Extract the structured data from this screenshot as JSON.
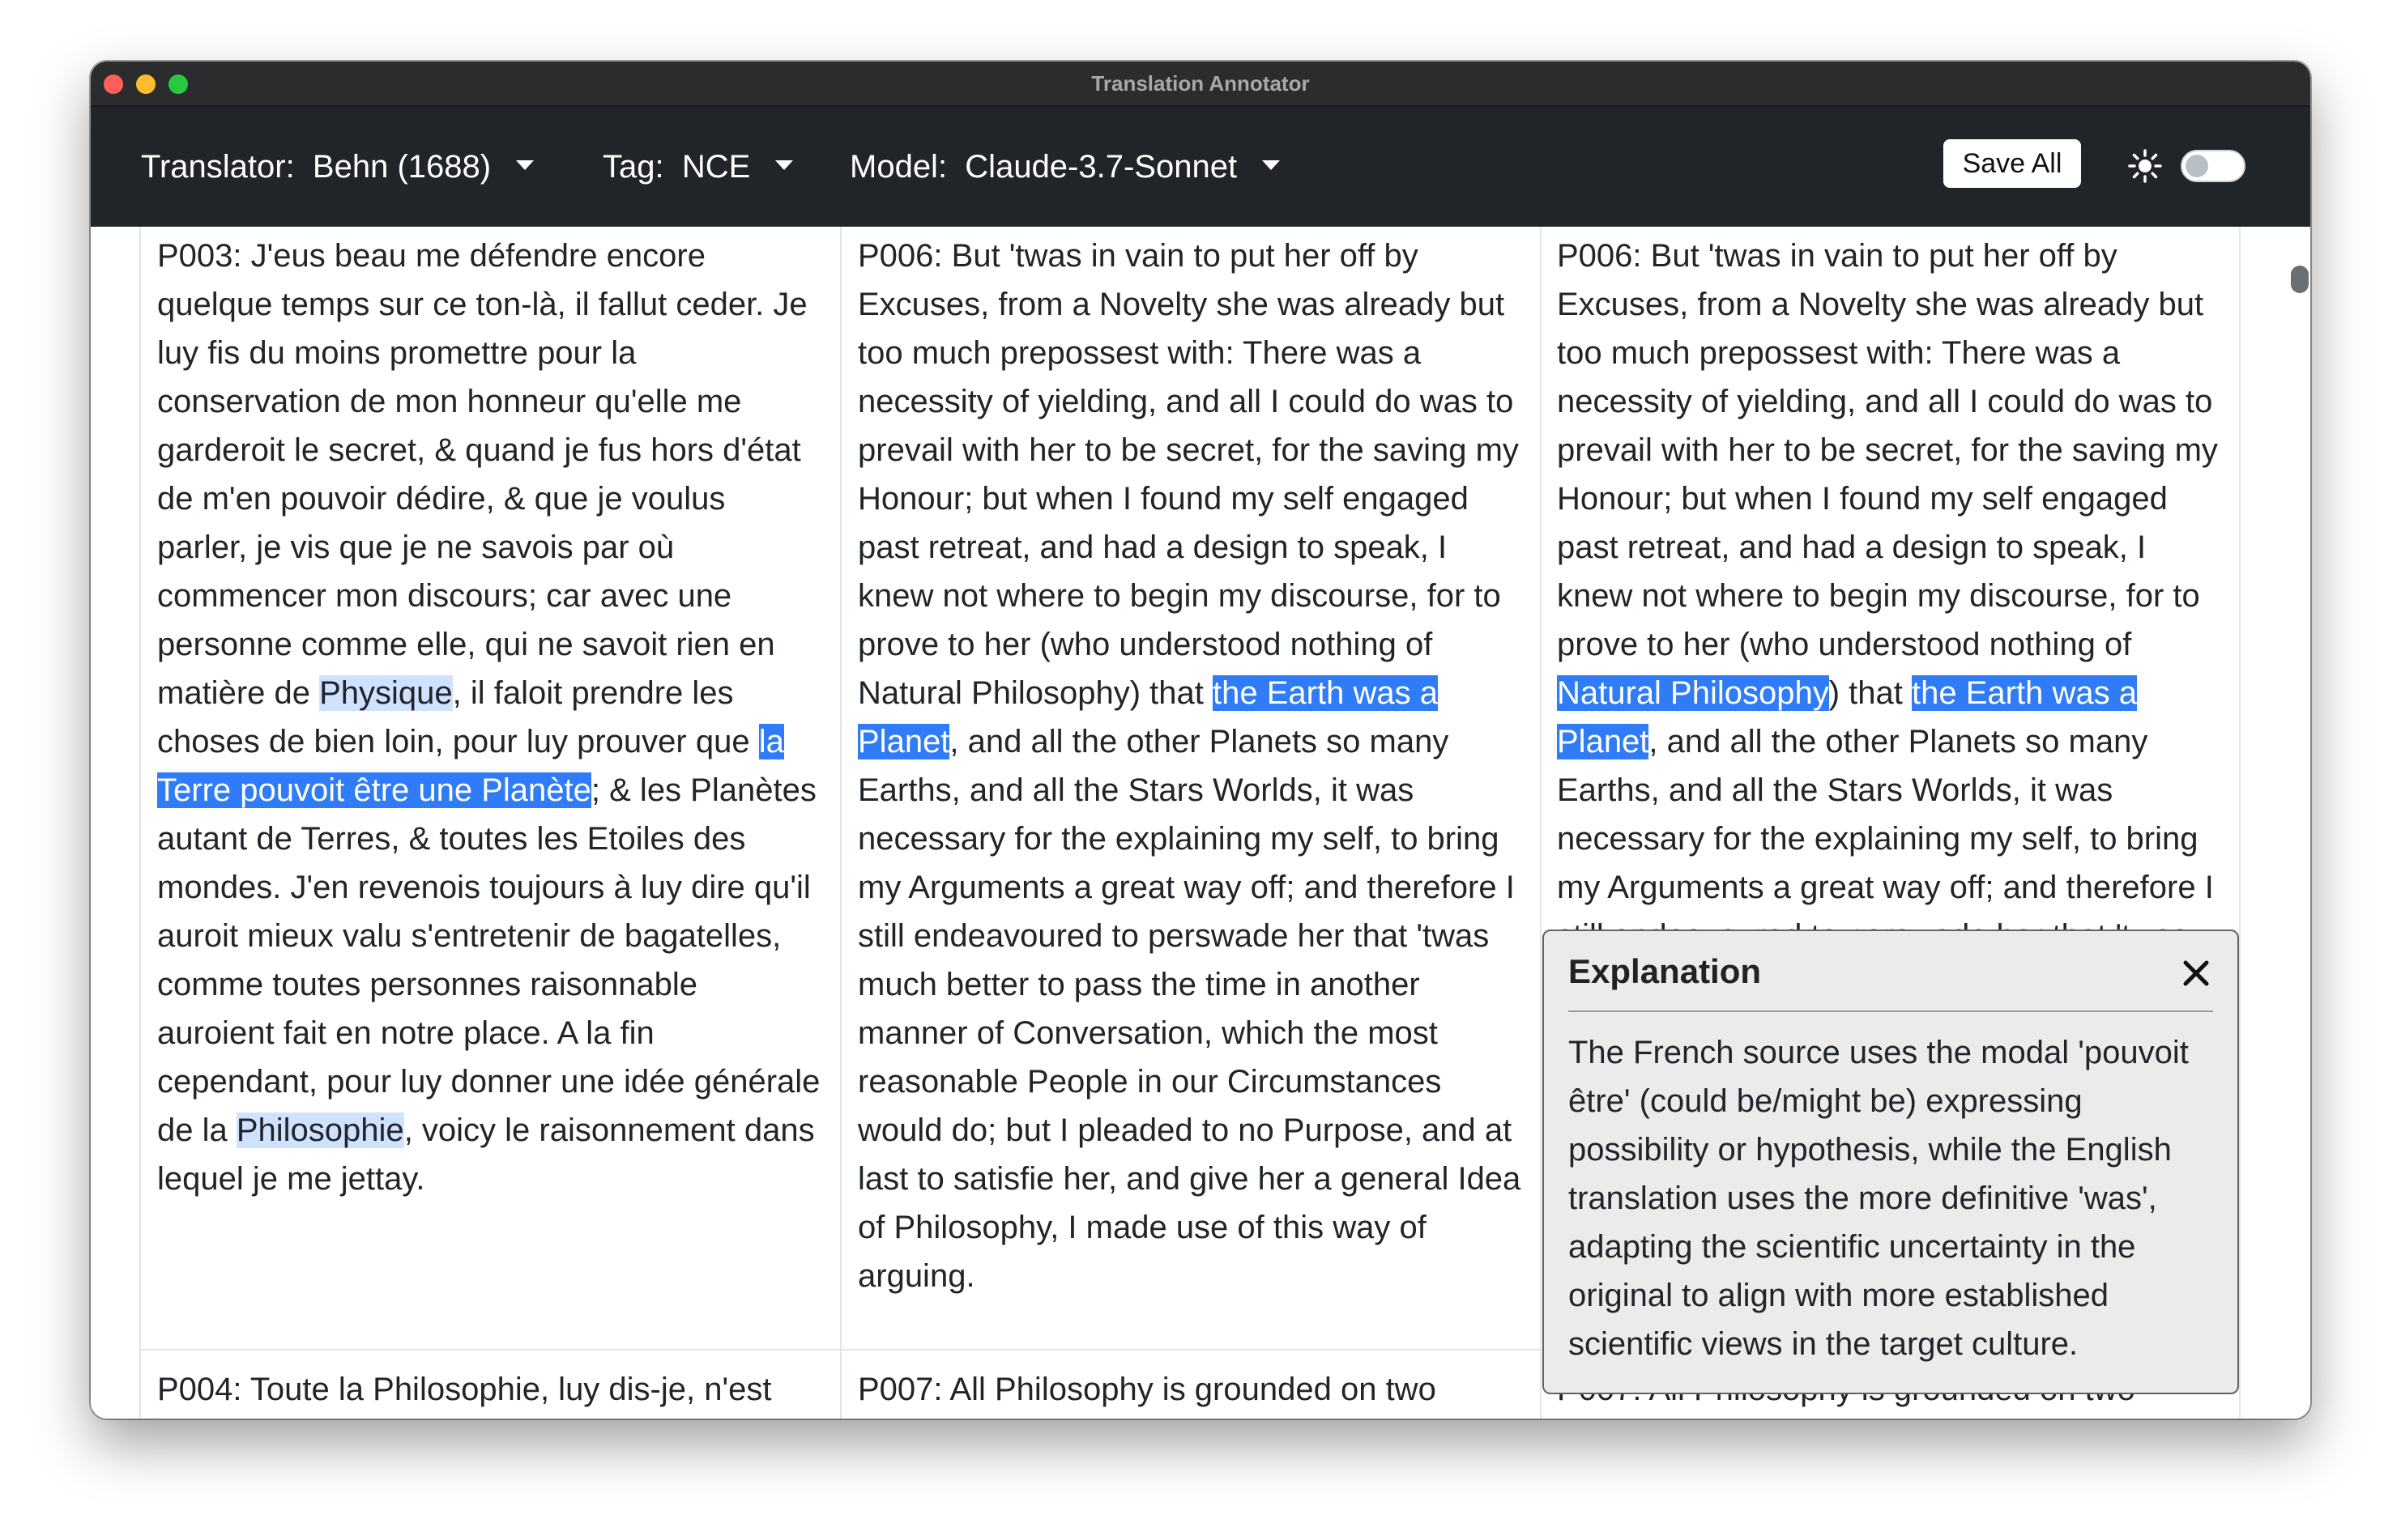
{
  "window": {
    "title": "Translation Annotator"
  },
  "toolbar": {
    "translator_label": "Translator:",
    "translator_value": "Behn (1688)",
    "tag_label": "Tag:",
    "tag_value": "NCE",
    "model_label": "Model:",
    "model_value": "Claude-3.7-Sonnet",
    "save_label": "Save All",
    "theme_icon": "sun-icon",
    "theme_toggle_on": false
  },
  "rows": [
    {
      "source_lines": [
        [
          "P003: J'eus beau me défendre encore"
        ],
        [
          "quelque temps sur ce ton-là, il fallut ceder. Je"
        ],
        [
          "luy fis du moins promettre pour la"
        ],
        [
          "conservation de mon honneur qu'elle me"
        ],
        [
          "garderoit le secret, & quand je fus hors d'état"
        ],
        [
          "de m'en pouvoir dédire, & que je voulus"
        ],
        [
          "parler, je vis que je ne savois par où"
        ],
        [
          "commencer mon discours; car avec une"
        ],
        [
          "personne comme elle, qui ne savoit rien en"
        ],
        [
          "matière de ",
          {
            "t": "Physique",
            "h": "soft"
          },
          ", il faloit prendre les"
        ],
        [
          "choses de bien loin, pour luy prouver que ",
          {
            "t": "la",
            "h": "strong"
          }
        ],
        [
          {
            "t": "Terre pouvoit être une Planète",
            "h": "strong"
          },
          "; & les Planètes"
        ],
        [
          "autant de Terres, & toutes les Etoiles des"
        ],
        [
          "mondes. J'en revenois toujours à luy dire qu'il"
        ],
        [
          "auroit mieux valu s'entretenir de bagatelles,"
        ],
        [
          "comme toutes personnes raisonnable"
        ],
        [
          "auroient fait en notre place. A la fin"
        ],
        [
          "cependant, pour luy donner une idée générale"
        ],
        [
          "de la ",
          {
            "t": "Philosophie",
            "h": "soft"
          },
          ", voicy le raisonnement dans"
        ],
        [
          "lequel je me jettay."
        ]
      ],
      "translation_lines": [
        [
          "P006: But 'twas in vain to put her off by"
        ],
        [
          "Excuses, from a Novelty she was already but"
        ],
        [
          "too much prepossest with: There was a"
        ],
        [
          "necessity of yielding, and all I could do was to"
        ],
        [
          "prevail with her to be secret, for the saving my"
        ],
        [
          "Honour; but when I found my self engaged"
        ],
        [
          "past retreat, and had a design to speak, I"
        ],
        [
          "knew not where to begin my discourse, for to"
        ],
        [
          "prove to her (who understood nothing of"
        ],
        [
          "Natural Philosophy) that ",
          {
            "t": "the Earth was a",
            "h": "strong"
          }
        ],
        [
          {
            "t": "Planet",
            "h": "strong"
          },
          ", and all the other Planets so many"
        ],
        [
          "Earths, and all the Stars Worlds, it was"
        ],
        [
          "necessary for the explaining my self, to bring"
        ],
        [
          "my Arguments a great way off; and therefore I"
        ],
        [
          "still endeavoured to perswade her that 'twas"
        ],
        [
          "much better to pass the time in another"
        ],
        [
          "manner of Conversation, which the most"
        ],
        [
          "reasonable People in our Circumstances"
        ],
        [
          "would do; but I pleaded to no Purpose, and at"
        ],
        [
          "last to satisfie her, and give her a general Idea"
        ],
        [
          "of Philosophy, I made use of this way of"
        ],
        [
          "arguing."
        ]
      ],
      "annotated_lines": [
        [
          "P006: But 'twas in vain to put her off by"
        ],
        [
          "Excuses, from a Novelty she was already but"
        ],
        [
          "too much prepossest with: There was a"
        ],
        [
          "necessity of yielding, and all I could do was to"
        ],
        [
          "prevail with her to be secret, for the saving my"
        ],
        [
          "Honour; but when I found my self engaged"
        ],
        [
          "past retreat, and had a design to speak, I"
        ],
        [
          "knew not where to begin my discourse, for to"
        ],
        [
          "prove to her (who understood nothing of"
        ],
        [
          {
            "t": "Natural Philosophy",
            "h": "strong"
          },
          ") that ",
          {
            "t": "the Earth was a",
            "h": "strong"
          }
        ],
        [
          {
            "t": "Planet",
            "h": "strong"
          },
          ", and all the other Planets so many"
        ],
        [
          "Earths, and all the Stars Worlds, it was"
        ],
        [
          "necessary for the explaining my self, to bring"
        ],
        [
          "my Arguments a great way off; and therefore I"
        ],
        [
          "still endeavoured to perswade her that 'twas"
        ]
      ]
    },
    {
      "source_lines": [
        [
          "P004: Toute la Philosophie, luy dis-je, n'est"
        ]
      ],
      "translation_lines": [
        [
          "P007: All Philosophy is grounded on two"
        ]
      ],
      "annotated_lines": [
        [
          "P007: All Philosophy is grounded on two"
        ]
      ]
    }
  ],
  "explanation": {
    "title": "Explanation",
    "close_icon": "close-icon",
    "body_lines": [
      "The French source uses the modal 'pouvoit",
      "être' (could be/might be) expressing",
      "possibility or hypothesis, while the English",
      "translation uses the more definitive 'was',",
      "adapting the scientific uncertainty in the",
      "original to align with more established",
      "scientific views in the target culture."
    ]
  }
}
